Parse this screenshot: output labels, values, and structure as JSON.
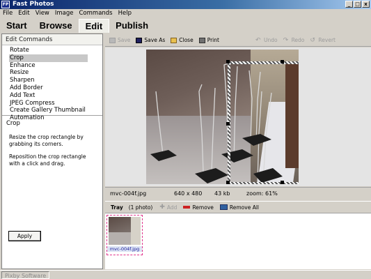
{
  "window": {
    "title": "Fast Photos",
    "app_icon_text": "FP",
    "controls": {
      "minimize": "_",
      "maximize": "□",
      "close": "x"
    }
  },
  "menu": [
    "File",
    "Edit",
    "View",
    "Image",
    "Commands",
    "Help"
  ],
  "nav": {
    "tabs": [
      "Start",
      "Browse",
      "Edit",
      "Publish"
    ],
    "active": "Edit"
  },
  "left_panel": {
    "section_title": "Edit Commands",
    "commands": [
      "Rotate",
      "Crop",
      "Enhance",
      "Resize",
      "Sharpen",
      "Add Border",
      "Add Text",
      "JPEG Compress",
      "Create Gallery Thumbnail",
      "Automation"
    ],
    "selected": "Crop",
    "detail_title": "Crop",
    "detail_paragraphs": [
      "Resize the crop rectangle by grabbing its corners.",
      "Reposition the crop rectangle with a click and drag."
    ],
    "apply_label": "Apply"
  },
  "toolbar": {
    "save": "Save",
    "save_as": "Save As",
    "close": "Close",
    "print": "Print",
    "undo": "Undo",
    "redo": "Redo",
    "revert": "Revert"
  },
  "image_info": {
    "filename": "mvc-004f.jpg",
    "dimensions": "640 x 480",
    "size": "43 kb",
    "zoom": "zoom: 61%"
  },
  "tray": {
    "title": "Tray",
    "count": "(1 photo)",
    "add": "Add",
    "remove": "Remove",
    "remove_all": "Remove All",
    "items": [
      "mvc-004f.jpg"
    ]
  },
  "status": {
    "brand": "Pixby Software"
  },
  "colors": {
    "selection": "#c8c8c8",
    "thumb_border": "#e0328c",
    "remove_icon": "#cc2222",
    "title_gradient_start": "#0a246a"
  }
}
